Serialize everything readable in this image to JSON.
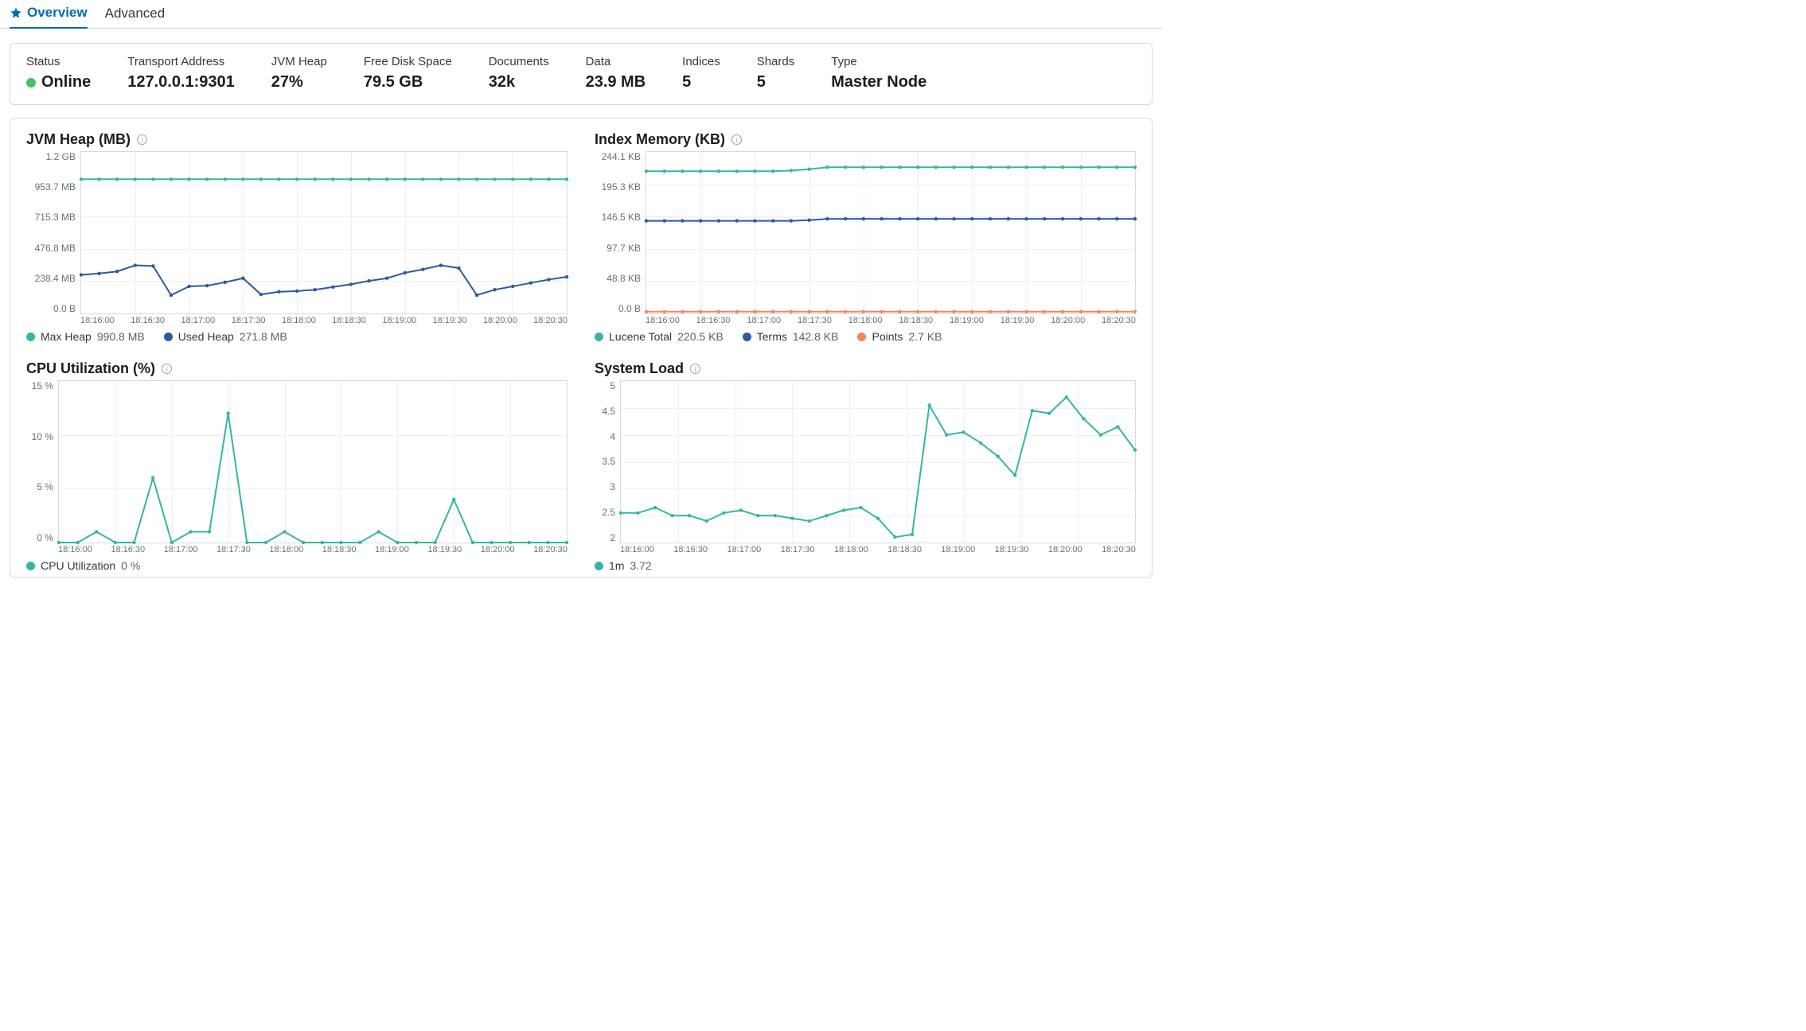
{
  "tabs": {
    "overview": "Overview",
    "advanced": "Advanced"
  },
  "stats": {
    "status_label": "Status",
    "status_value": "Online",
    "transport_label": "Transport Address",
    "transport_value": "127.0.0.1:9301",
    "jvm_label": "JVM Heap",
    "jvm_value": "27%",
    "disk_label": "Free Disk Space",
    "disk_value": "79.5 GB",
    "docs_label": "Documents",
    "docs_value": "32k",
    "data_label": "Data",
    "data_value": "23.9 MB",
    "indices_label": "Indices",
    "indices_value": "5",
    "shards_label": "Shards",
    "shards_value": "5",
    "type_label": "Type",
    "type_value": "Master Node"
  },
  "colors": {
    "teal": "#36b5a6",
    "blue": "#2c5aa0",
    "orange": "#f5855b"
  },
  "chart_data": [
    {
      "id": "jvm-heap",
      "title": "JVM Heap (MB)",
      "type": "line",
      "yticks": [
        "1.2 GB",
        "953.7 MB",
        "715.3 MB",
        "476.8 MB",
        "238.4 MB",
        "0.0 B"
      ],
      "xcats": [
        "18:16:00",
        "18:16:30",
        "18:17:00",
        "18:17:30",
        "18:18:00",
        "18:18:30",
        "18:19:00",
        "18:19:30",
        "18:20:00",
        "18:20:30"
      ],
      "ymin": 0,
      "ymax": 1192.1,
      "series": [
        {
          "name": "Max Heap",
          "value_label": "990.8 MB",
          "color": "teal",
          "values": [
            990.8,
            990.8,
            990.8,
            990.8,
            990.8,
            990.8,
            990.8,
            990.8,
            990.8,
            990.8,
            990.8,
            990.8,
            990.8,
            990.8,
            990.8,
            990.8,
            990.8,
            990.8,
            990.8,
            990.8,
            990.8,
            990.8,
            990.8,
            990.8,
            990.8,
            990.8,
            990.8,
            990.8
          ]
        },
        {
          "name": "Used Heap",
          "value_label": "271.8 MB",
          "color": "blue",
          "values": [
            285,
            295,
            310,
            355,
            350,
            135,
            200,
            205,
            230,
            260,
            140,
            160,
            165,
            175,
            195,
            215,
            240,
            260,
            300,
            325,
            355,
            335,
            135,
            175,
            200,
            225,
            250,
            270
          ]
        }
      ]
    },
    {
      "id": "index-memory",
      "title": "Index Memory (KB)",
      "type": "line",
      "yticks": [
        "244.1 KB",
        "195.3 KB",
        "146.5 KB",
        "97.7 KB",
        "48.8 KB",
        "0.0 B"
      ],
      "xcats": [
        "18:16:00",
        "18:16:30",
        "18:17:00",
        "18:17:30",
        "18:18:00",
        "18:18:30",
        "18:19:00",
        "18:19:30",
        "18:20:00",
        "18:20:30"
      ],
      "ymin": 0,
      "ymax": 244.1,
      "series": [
        {
          "name": "Lucene Total",
          "value_label": "220.5 KB",
          "color": "teal",
          "values": [
            215,
            215,
            215,
            215,
            215,
            215,
            215,
            215,
            216,
            218,
            221,
            221,
            221,
            221,
            221,
            221,
            221,
            221,
            221,
            221,
            221,
            221,
            221,
            221,
            221,
            221,
            221,
            221
          ]
        },
        {
          "name": "Terms",
          "value_label": "142.8 KB",
          "color": "blue",
          "values": [
            140,
            140,
            140,
            140,
            140,
            140,
            140,
            140,
            140,
            141,
            143,
            143,
            143,
            143,
            143,
            143,
            143,
            143,
            143,
            143,
            143,
            143,
            143,
            143,
            143,
            143,
            143,
            143
          ]
        },
        {
          "name": "Points",
          "value_label": "2.7 KB",
          "color": "orange",
          "values": [
            2.7,
            2.7,
            2.7,
            2.7,
            2.7,
            2.7,
            2.7,
            2.7,
            2.7,
            2.7,
            2.7,
            2.7,
            2.7,
            2.7,
            2.7,
            2.7,
            2.7,
            2.7,
            2.7,
            2.7,
            2.7,
            2.7,
            2.7,
            2.7,
            2.7,
            2.7,
            2.7,
            2.7
          ]
        }
      ]
    },
    {
      "id": "cpu",
      "title": "CPU Utilization (%)",
      "type": "line",
      "yticks": [
        "15 %",
        "10 %",
        "5 %",
        "0 %"
      ],
      "xcats": [
        "18:16:00",
        "18:16:30",
        "18:17:00",
        "18:17:30",
        "18:18:00",
        "18:18:30",
        "18:19:00",
        "18:19:30",
        "18:20:00",
        "18:20:30"
      ],
      "ymin": 0,
      "ymax": 15,
      "series": [
        {
          "name": "CPU Utilization",
          "value_label": "0 %",
          "color": "teal",
          "values": [
            0,
            0,
            1,
            0,
            0,
            6,
            0,
            1,
            1,
            12,
            0,
            0,
            1,
            0,
            0,
            0,
            0,
            1,
            0,
            0,
            0,
            4,
            0,
            0,
            0,
            0,
            0,
            0
          ]
        }
      ]
    },
    {
      "id": "system-load",
      "title": "System Load",
      "type": "line",
      "yticks": [
        "5",
        "4.5",
        "4",
        "3.5",
        "3",
        "2.5",
        "2"
      ],
      "xcats": [
        "18:16:00",
        "18:16:30",
        "18:17:00",
        "18:17:30",
        "18:18:00",
        "18:18:30",
        "18:19:00",
        "18:19:30",
        "18:20:00",
        "18:20:30"
      ],
      "ymin": 2,
      "ymax": 5,
      "series": [
        {
          "name": "1m",
          "value_label": "3.72",
          "color": "teal",
          "values": [
            2.55,
            2.55,
            2.65,
            2.5,
            2.5,
            2.4,
            2.55,
            2.6,
            2.5,
            2.5,
            2.45,
            2.4,
            2.5,
            2.6,
            2.65,
            2.45,
            2.1,
            2.15,
            4.55,
            4.0,
            4.05,
            3.85,
            3.6,
            3.25,
            4.45,
            4.4,
            4.7,
            4.3,
            4.0,
            4.15,
            3.72
          ]
        }
      ]
    }
  ]
}
